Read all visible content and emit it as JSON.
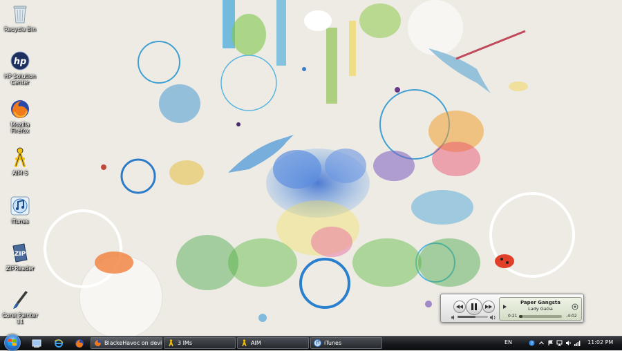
{
  "desktop_icons": [
    {
      "label": "Recycle Bin",
      "icon": "recycle-bin-icon"
    },
    {
      "label": "HP Solution Center",
      "icon": "hp-icon"
    },
    {
      "label": "Mozilla Firefox",
      "icon": "firefox-icon"
    },
    {
      "label": "AIM 6",
      "icon": "aim-icon"
    },
    {
      "label": "iTunes",
      "icon": "itunes-icon"
    },
    {
      "label": "ZIPReader",
      "icon": "zip-icon"
    },
    {
      "label": "Corel Painter 11",
      "icon": "brush-icon"
    }
  ],
  "taskbar": {
    "buttons": [
      {
        "label": "BlackeHavoc on devi...",
        "icon": "firefox-icon",
        "active": true
      },
      {
        "label": "3 IMs",
        "icon": "aim-icon",
        "active": false
      },
      {
        "label": "AIM",
        "icon": "aim-icon",
        "active": false
      },
      {
        "label": "iTunes",
        "icon": "itunes-icon",
        "active": false
      }
    ],
    "language": "EN",
    "clock": "11:02 PM"
  },
  "itunes_mini": {
    "song": "Paper Gangsta",
    "artist": "Lady GaGa",
    "elapsed": "0:21",
    "remaining": "-4:02",
    "progress": 0.08,
    "volume": 0.6
  },
  "colors": {
    "taskbar": "#16181b",
    "accent": "#2d7bd4",
    "wallpaper_bg": "#eeece6"
  }
}
